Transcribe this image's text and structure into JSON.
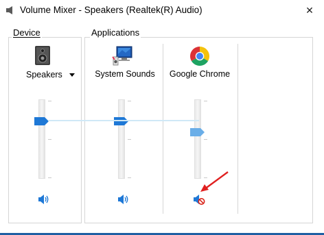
{
  "window": {
    "title": "Volume Mixer - Speakers (Realtek(R) Audio)",
    "close_glyph": "✕"
  },
  "device_group": {
    "label": "Device",
    "device_name": "Speakers",
    "slider_level": 0.75,
    "muted": false
  },
  "applications_group": {
    "label": "Applications",
    "apps": [
      {
        "name": "System Sounds",
        "icon": "system-sounds-icon",
        "slider_level": 0.75,
        "muted": false
      },
      {
        "name": "Google Chrome",
        "icon": "chrome-icon",
        "slider_level": 0.6,
        "muted": true
      }
    ]
  },
  "colors": {
    "accent": "#1e78d6",
    "thumb_disabled": "#6aaee8",
    "mute_red": "#d9261c",
    "annotation_arrow": "#e02020",
    "window_bottom": "#1e5fa3"
  }
}
